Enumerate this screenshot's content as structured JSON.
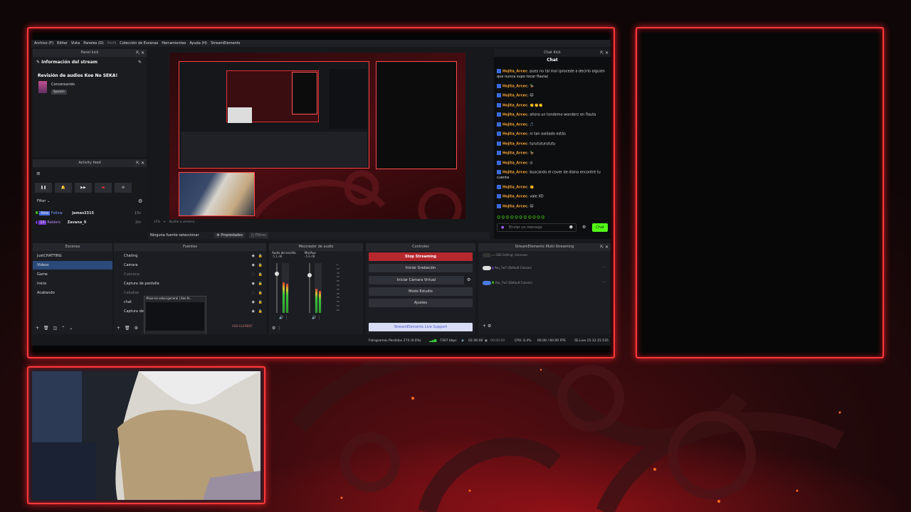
{
  "obs": {
    "menu": [
      "Archivo (F)",
      "Editar",
      "Vista",
      "Paneles (D)",
      "Perfil",
      "Colección de Escenas",
      "Herramientas",
      "Ayuda (H)",
      "StreamElements"
    ],
    "panel_kick": {
      "title": "Panel kick",
      "section": "Información del stream",
      "stream_title": "Revisión de audios Koe No SEKA!",
      "category": "Conversando",
      "language": "Spanish"
    },
    "activity_feed": {
      "title": "Activity feed",
      "filter_label": "Filter",
      "events": [
        {
          "badge": "New",
          "type": "Follow",
          "user": "James3315",
          "time": "15s"
        },
        {
          "badge": "13",
          "type": "Raiders",
          "user": "Zavana_9",
          "time": "2m"
        }
      ]
    },
    "preview_toolbar": {
      "zoom": "11%",
      "mode": "Ajustar a ventana"
    },
    "source_bar": {
      "no_source": "Ninguna fuente seleccionar",
      "properties": "Propiedades",
      "filters": "Filtros"
    },
    "chat_kick": {
      "panel_title": "Chat Kick",
      "header": "Chat",
      "messages": [
        {
          "user": "Hojita_Arcec",
          "text": "pues no tal mal (procede a decirlo alguien que nunca supo tocar flauta)"
        },
        {
          "user": "Hojita_Arcec",
          "text": "🦆"
        },
        {
          "user": "Hojita_Arcec",
          "text": "🐱"
        },
        {
          "user": "Hojita_Arcec",
          "text": "👏👏👏"
        },
        {
          "user": "Hojita_Arcec",
          "text": "ahora un tondemo wonderz en flauta"
        },
        {
          "user": "Hojita_Arcec",
          "text": "🎵"
        },
        {
          "user": "Hojita_Arcec",
          "text": "ni tan oxidado estás"
        },
        {
          "user": "Hojita_Arcec",
          "text": "turututurututu"
        },
        {
          "user": "Hojita_Arcec",
          "text": "🦆"
        },
        {
          "user": "Hojita_Arcec",
          "text": "si"
        },
        {
          "user": "Hojita_Arcec",
          "text": "buscando el cover de diana encontré tu cuenta"
        },
        {
          "user": "Hojita_Arcec",
          "text": "👏"
        },
        {
          "user": "Hojita_Arcec",
          "text": "vale XD"
        },
        {
          "user": "Hojita_Arcec",
          "text": "🐱"
        }
      ],
      "input_placeholder": "Enviar un mensaje",
      "send_label": "Chat"
    },
    "scenes": {
      "title": "Escenas",
      "items": [
        "JustCHATTING",
        "Videos",
        "Game",
        "Inicio",
        "Acabando"
      ],
      "selected": "Videos"
    },
    "sources": {
      "title": "Fuentes",
      "items": [
        "Chating",
        "Camara",
        "Cuevana",
        "Captura de pantalla",
        "Caballas",
        "chat",
        "Captura de"
      ],
      "popup": "#koe-no-sekai-general | Koe N...",
      "add_element": "ADD ELEMENT"
    },
    "audio": {
      "title": "Mezclador de audio",
      "channels": [
        {
          "name": "Audio del escrito",
          "db": "-5.1 dB",
          "level": 0.62
        },
        {
          "name": "Mic/Aux",
          "db": "-5.6 dB",
          "level": 0.48
        }
      ],
      "ticks": [
        "-5",
        "-10",
        "-15",
        "-20",
        "-25",
        "-30",
        "-35",
        "-40",
        "-45",
        "-50",
        "-55",
        "-60"
      ]
    },
    "controls": {
      "title": "Controles",
      "buttons": [
        "Stop Streaming",
        "Iniciar Grabación",
        "Iniciar Cámara Virtual",
        "Modo Estudio",
        "Ajustes"
      ],
      "live_support": "StreamElements Live Support"
    },
    "multistream": {
      "title": "StreamElements Multi-Streaming",
      "rows": [
        {
          "label": "OBS Setting: Unknown"
        },
        {
          "label": "You_7w7 (Default Canvas)"
        },
        {
          "label": "You_7w7 (Default Canvas)"
        }
      ]
    },
    "statusbar": {
      "frames": "Fotogramas Perdidos 274 (0.0%)",
      "kbps": "7307 kbps",
      "live_time": "02:36:08",
      "rec_time": "00:00:00",
      "cpu": "CPU: 6.4%",
      "fps": "60.00 / 60.00 FPS",
      "version": "SE.Live 25.12.15.535"
    }
  },
  "colors": {
    "frame_red": "#ff3a3a",
    "stop_button": "#b5282e",
    "kick_green": "#53fc18",
    "username": "#f0a030"
  }
}
